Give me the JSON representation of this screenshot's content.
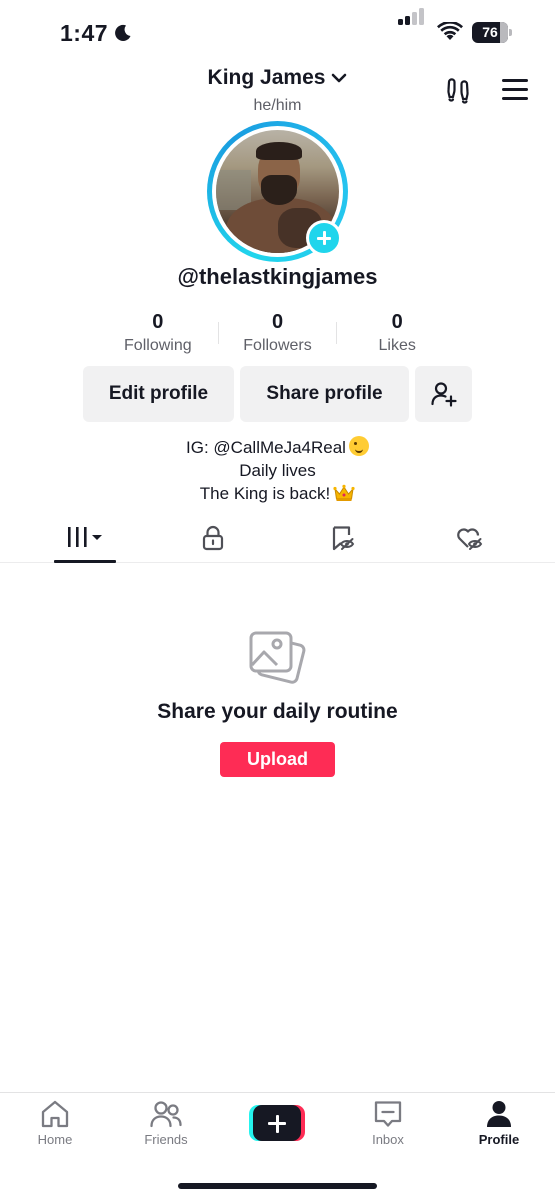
{
  "status_bar": {
    "time": "1:47",
    "battery_level": "76"
  },
  "header": {
    "display_name": "King James",
    "pronouns": "he/him"
  },
  "profile": {
    "username": "@thelastkingjames"
  },
  "stats": [
    {
      "value": "0",
      "label": "Following"
    },
    {
      "value": "0",
      "label": "Followers"
    },
    {
      "value": "0",
      "label": "Likes"
    }
  ],
  "buttons": {
    "edit_profile": "Edit profile",
    "share_profile": "Share profile"
  },
  "bio": {
    "line1": "IG: @CallMeJa4Real",
    "line2": "Daily lives",
    "line3": "The King is back!"
  },
  "tabs": [
    {
      "name": "videos",
      "icon": "grid-icon",
      "active": true
    },
    {
      "name": "private",
      "icon": "lock-icon",
      "active": false
    },
    {
      "name": "favorites",
      "icon": "bookmark-hidden-icon",
      "active": false
    },
    {
      "name": "liked",
      "icon": "heart-hidden-icon",
      "active": false
    }
  ],
  "empty_state": {
    "title": "Share your daily routine",
    "upload_label": "Upload"
  },
  "bottom_nav": {
    "items": [
      {
        "label": "Home",
        "icon": "home-icon"
      },
      {
        "label": "Friends",
        "icon": "friends-icon"
      },
      {
        "label": "",
        "icon": "create-plus-icon"
      },
      {
        "label": "Inbox",
        "icon": "inbox-icon"
      },
      {
        "label": "Profile",
        "icon": "profile-icon",
        "active": true
      }
    ]
  },
  "colors": {
    "accent_red": "#fe2c55",
    "accent_cyan": "#20d5ec",
    "text_primary": "#161823",
    "text_secondary": "#5f6068",
    "button_bg": "#f1f1f2"
  }
}
